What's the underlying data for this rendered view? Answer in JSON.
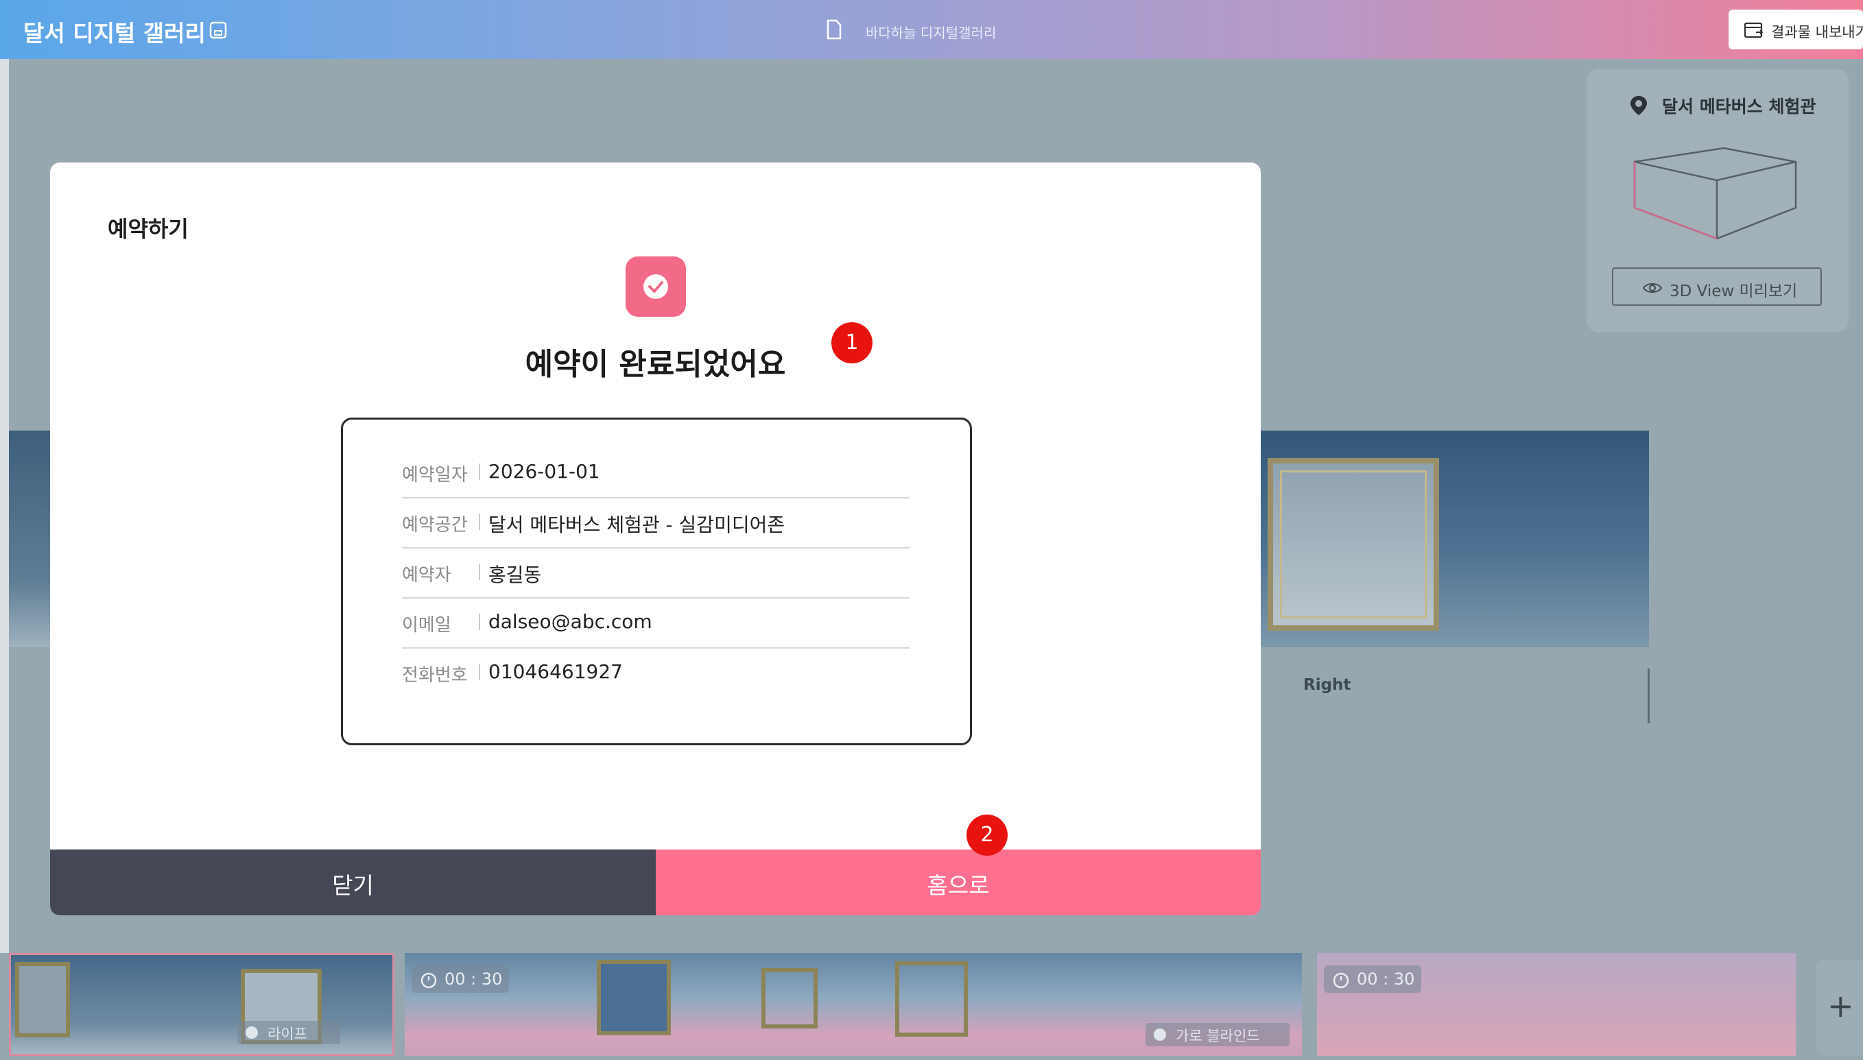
{
  "app": {
    "title": "달서 디지털 갤러리",
    "document_name": "바다하늘 디지털갤러리"
  },
  "topbar": {
    "export_label": "결과물 내보내기"
  },
  "right_panel": {
    "title": "달서 메타버스 체험관",
    "view3d_label": "3D View 미리보기"
  },
  "scene": {
    "right_label": "Right"
  },
  "timeline": {
    "clips": [
      {
        "timer": "",
        "effect": "라이프"
      },
      {
        "timer": "00 : 30",
        "effect": "가로 블라인드"
      },
      {
        "timer": "00 : 30",
        "effect": ""
      }
    ],
    "add_label": "+"
  },
  "modal": {
    "title": "예약하기",
    "message": "예약이 완료되었어요",
    "rows": [
      {
        "label": "예약일자",
        "value": "2026-01-01"
      },
      {
        "label": "예약공간",
        "value": "달서 메타버스 체험관 - 실감미디어존"
      },
      {
        "label": "예약자",
        "value": "홍길동"
      },
      {
        "label": "이메일",
        "value": "dalseo@abc.com"
      },
      {
        "label": "전화번호",
        "value": "01046461927"
      }
    ],
    "close_label": "닫기",
    "home_label": "홈으로"
  },
  "markers": [
    "1",
    "2"
  ],
  "colors": {
    "accent": "#ff6f8f",
    "dark_button": "#454755",
    "marker": "#e8130f"
  }
}
